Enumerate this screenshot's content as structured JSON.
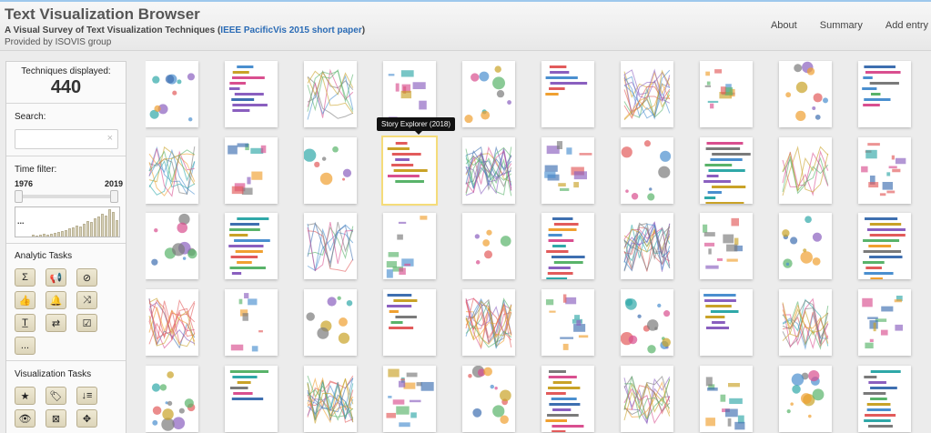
{
  "header": {
    "title": "Text Visualization Browser",
    "subtitle_prefix": "A Visual Survey of Text Visualization Techniques (",
    "subtitle_link": "IEEE PacificVis 2015 short paper",
    "subtitle_suffix": ")",
    "provided_by": "Provided by ISOVIS group"
  },
  "nav": {
    "about": "About",
    "summary": "Summary",
    "add_entry": "Add entry"
  },
  "sidebar": {
    "count_label": "Techniques displayed:",
    "count_value": "440",
    "search_label": "Search:",
    "search_value": "",
    "search_clear_icon": "×",
    "time_label": "Time filter:",
    "year_min": "1976",
    "year_max": "2019",
    "histogram_more": "...",
    "histogram": [
      2,
      1,
      2,
      3,
      2,
      3,
      4,
      5,
      6,
      7,
      9,
      10,
      12,
      11,
      14,
      17,
      16,
      20,
      22,
      25,
      23,
      30,
      27,
      18
    ],
    "analytic_title": "Analytic Tasks",
    "analytic_tasks": [
      {
        "glyph": "Σ",
        "name": "summarization-icon"
      },
      {
        "glyph": "📢",
        "name": "megaphone-icon"
      },
      {
        "glyph": "⊘",
        "name": "compass-icon"
      },
      {
        "glyph": "👍",
        "name": "thumbs-up-icon"
      },
      {
        "glyph": "🔔",
        "name": "bell-icon"
      },
      {
        "glyph": "⤨",
        "name": "shuffle-icon"
      },
      {
        "glyph": "T̲",
        "name": "text-underline-icon"
      },
      {
        "glyph": "⇄",
        "name": "retweet-icon"
      },
      {
        "glyph": "☑",
        "name": "check-square-icon"
      },
      {
        "glyph": "...",
        "name": "more-icon"
      }
    ],
    "vis_title": "Visualization Tasks",
    "vis_tasks": [
      {
        "glyph": "★",
        "name": "star-icon"
      },
      {
        "glyph": "🏷",
        "name": "tags-icon"
      },
      {
        "glyph": "↓≡",
        "name": "sort-icon"
      },
      {
        "glyph": "👁",
        "name": "eye-icon"
      },
      {
        "glyph": "⊠",
        "name": "filter-icon"
      },
      {
        "glyph": "✥",
        "name": "move-icon"
      }
    ]
  },
  "tooltip": "Story Explorer (2018)",
  "thumb_colors": [
    "#4a8fcf",
    "#e25b5b",
    "#59b36a",
    "#f0a030",
    "#8a5fbf",
    "#2fa8a8",
    "#d94f8f",
    "#7a7a7a",
    "#c9a227",
    "#3e6fb0"
  ]
}
